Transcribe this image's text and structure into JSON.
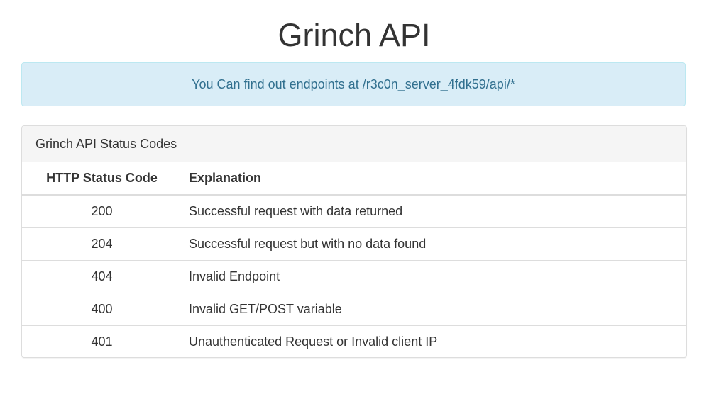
{
  "header": {
    "title": "Grinch API"
  },
  "alert": {
    "text": "You Can find out endpoints at /r3c0n_server_4fdk59/api/*",
    "background": "#d9edf7",
    "color": "#31708f"
  },
  "panel": {
    "heading": "Grinch API Status Codes",
    "table": {
      "headers": [
        "HTTP Status Code",
        "Explanation"
      ],
      "rows": [
        {
          "code": "200",
          "explanation": "Successful request with data returned"
        },
        {
          "code": "204",
          "explanation": "Successful request but with no data found"
        },
        {
          "code": "404",
          "explanation": "Invalid Endpoint"
        },
        {
          "code": "400",
          "explanation": "Invalid GET/POST variable"
        },
        {
          "code": "401",
          "explanation": "Unauthenticated Request or Invalid client IP"
        }
      ]
    }
  }
}
